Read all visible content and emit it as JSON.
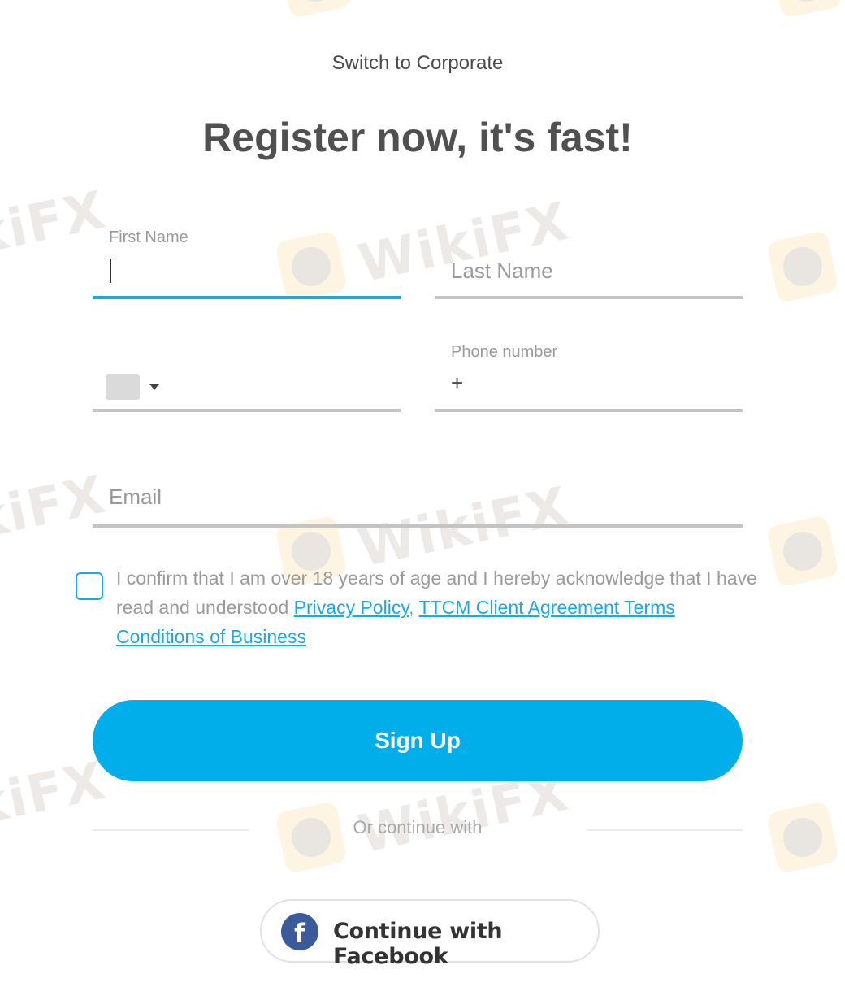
{
  "header": {
    "switch_link": "Switch to Corporate",
    "title": "Register now, it's fast!"
  },
  "form": {
    "first_name": {
      "label": "First Name",
      "value": "",
      "focused": true
    },
    "last_name": {
      "placeholder": "Last Name",
      "value": ""
    },
    "country_code": {
      "selected_flag": "",
      "icon": "chevron-down-icon"
    },
    "phone": {
      "label": "Phone number",
      "prefix": "+",
      "value": ""
    },
    "email": {
      "placeholder": "Email",
      "value": ""
    },
    "consent": {
      "checked": false,
      "text_before": "I confirm that I am over 18 years of age and I hereby acknowledge that I have read and understood ",
      "link_privacy": "Privacy Policy",
      "separator": ", ",
      "link_terms": "TTCM Client Agreement Terms Conditions of Business"
    },
    "signup_label": "Sign Up"
  },
  "social": {
    "divider_text": "Or continue with",
    "facebook_label": "Continue with Facebook",
    "facebook_icon": "f"
  },
  "watermark": {
    "text": "WikiFX"
  },
  "colors": {
    "accent": "#02aeea",
    "link": "#1aa9e0",
    "facebook": "#3a5a99",
    "title": "#505050"
  }
}
